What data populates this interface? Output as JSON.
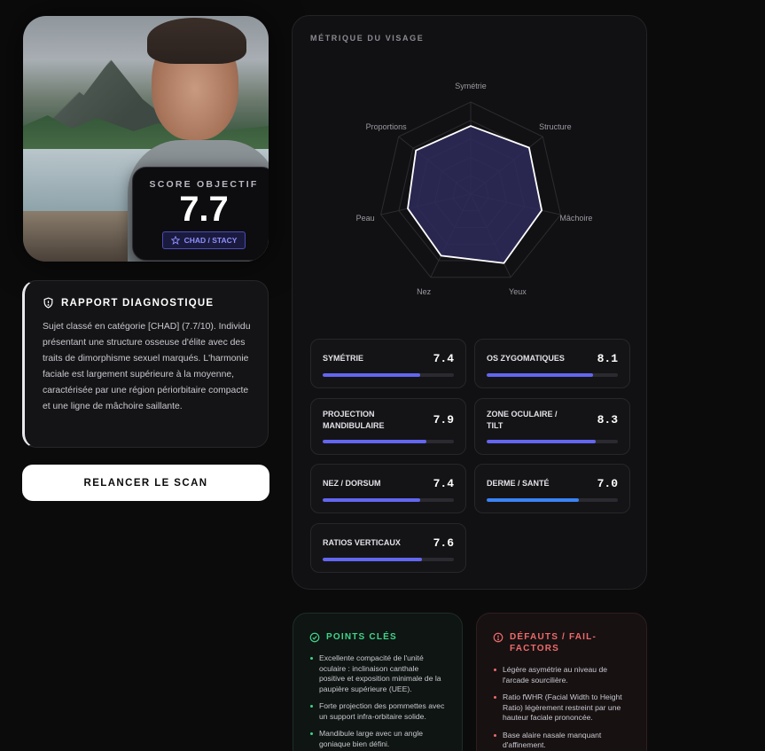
{
  "photo": {
    "alt": "Portrait photo"
  },
  "score": {
    "label": "SCORE OBJECTIF",
    "value": "7.7",
    "badge": "CHAD / STACY"
  },
  "report": {
    "title": "RAPPORT DIAGNOSTIQUE",
    "text": "Sujet classé en catégorie [CHAD] (7.7/10). Individu présentant une structure osseuse d'élite avec des traits de dimorphisme sexuel marqués. L'harmonie faciale est largement supérieure à la moyenne, caractérisée par une région périorbitaire compacte et une ligne de mâchoire saillante."
  },
  "rescan_label": "RELANCER LE SCAN",
  "metrics": {
    "title": "MÉTRIQUE DU VISAGE",
    "radar_axes": [
      {
        "label": "Symétrie",
        "value": 7.4
      },
      {
        "label": "Structure",
        "value": 8.1
      },
      {
        "label": "Mâchoire",
        "value": 7.9
      },
      {
        "label": "Yeux",
        "value": 8.3
      },
      {
        "label": "Nez",
        "value": 7.4
      },
      {
        "label": "Peau",
        "value": 7.0
      },
      {
        "label": "Proportions",
        "value": 7.6
      }
    ],
    "radar_max": 10,
    "cards": [
      {
        "label": "SYMÉTRIE",
        "value": "7.4",
        "fraction": 0.74,
        "color": "#6366f1"
      },
      {
        "label": "OS ZYGOMATIQUES",
        "value": "8.1",
        "fraction": 0.81,
        "color": "#6366f1"
      },
      {
        "label": "PROJECTION MANDIBULAIRE",
        "value": "7.9",
        "fraction": 0.79,
        "color": "#6366f1"
      },
      {
        "label": "ZONE OCULAIRE / TILT",
        "value": "8.3",
        "fraction": 0.83,
        "color": "#6366f1"
      },
      {
        "label": "NEZ / DORSUM",
        "value": "7.4",
        "fraction": 0.74,
        "color": "#6366f1"
      },
      {
        "label": "DERME / SANTÉ",
        "value": "7.0",
        "fraction": 0.7,
        "color": "#3b82f6"
      },
      {
        "label": "RATIOS VERTICAUX",
        "value": "7.6",
        "fraction": 0.76,
        "color": "#6366f1"
      }
    ]
  },
  "key_points": {
    "title": "POINTS CLÉS",
    "items": [
      "Excellente compacité de l'unité oculaire : inclinaison canthale positive et exposition minimale de la paupière supérieure (UEE).",
      "Forte projection des pommettes avec un support infra-orbitaire solide.",
      "Mandibule large avec un angle goniaque bien défini."
    ]
  },
  "fail_factors": {
    "title": "DÉFAUTS / FAIL-FACTORS",
    "items": [
      "Légère asymétrie au niveau de l'arcade sourcilière.",
      "Ratio fWHR (Facial Width to Height Ratio) légèrement restreint par une hauteur faciale prononcée.",
      "Base alaire nasale manquant d'affinement."
    ]
  },
  "colors": {
    "accent": "#6366f1",
    "positive": "#3fd48a",
    "negative": "#f06a6a"
  }
}
